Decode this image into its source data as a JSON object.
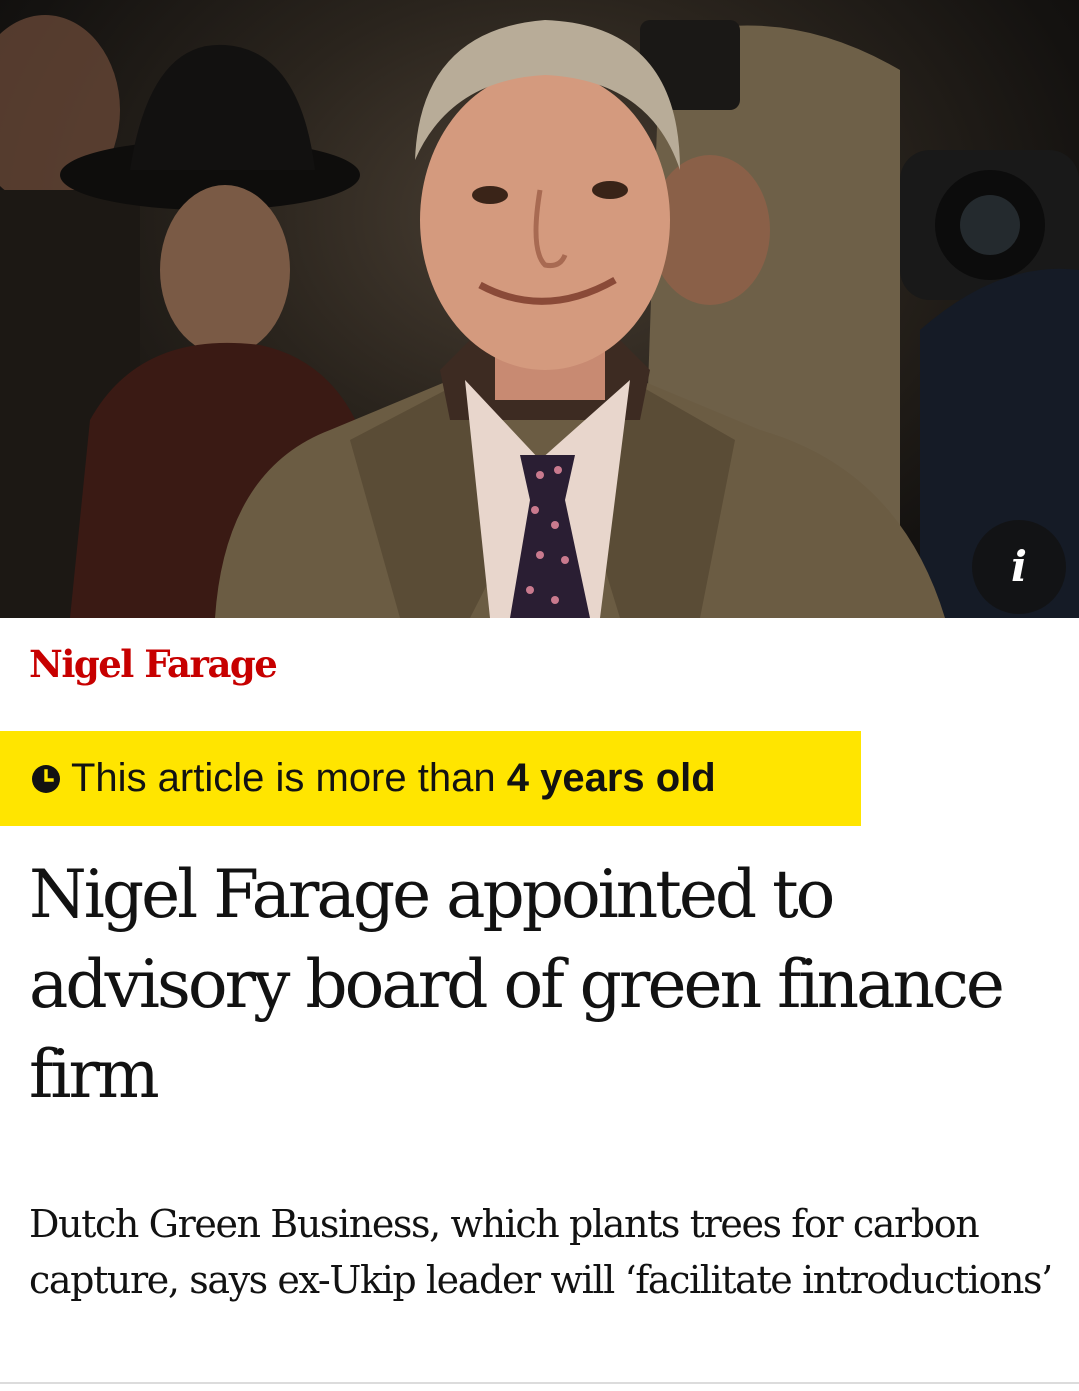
{
  "hero": {
    "photo_subject": "man-in-tweed-coat-smiling-among-photographers",
    "info_icon": "info-icon",
    "info_label": "i"
  },
  "article": {
    "kicker": "Nigel Farage",
    "age_notice": {
      "icon": "clock-icon",
      "prefix": "This article is more than",
      "emphasis": "4 years old"
    },
    "headline": "Nigel Farage appointed to advisory board of green finance firm",
    "standfirst": "Dutch Green Business, which plants trees for carbon capture, says ex-Ukip leader will ‘facilitate introductions’"
  },
  "colors": {
    "kicker": "#c70000",
    "banner": "#ffe500",
    "text": "#121212"
  }
}
